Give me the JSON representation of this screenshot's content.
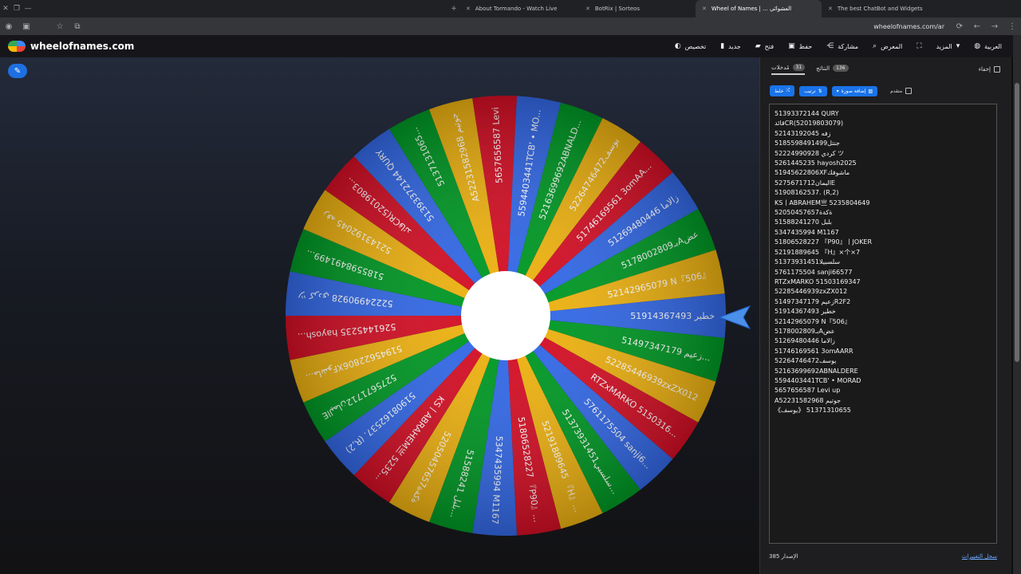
{
  "browser": {
    "tabs": [
      {
        "label": "About Tormando - Watch Live",
        "active": false
      },
      {
        "label": "BotRix | Sorteos",
        "active": false
      },
      {
        "label": "Wheel of Names | ... العشوائي",
        "active": true
      },
      {
        "label": "The best ChatBot and Widgets",
        "active": false
      }
    ],
    "url": "wheelofnames.com/ar"
  },
  "app": {
    "brand": "wheelofnames.com",
    "menu": [
      {
        "label": "تخصيص",
        "icon": "palette-icon"
      },
      {
        "label": "جديد",
        "icon": "new-file-icon"
      },
      {
        "label": "فتح",
        "icon": "folder-icon"
      },
      {
        "label": "حفظ",
        "icon": "save-icon"
      },
      {
        "label": "مشاركة",
        "icon": "share-icon"
      },
      {
        "label": "المعرض",
        "icon": "search-icon"
      },
      {
        "label": "المزيد",
        "icon": "fullscreen-icon"
      },
      {
        "label": "العربية",
        "icon": "globe-icon"
      }
    ]
  },
  "panel": {
    "tabs": [
      {
        "label": "مُدخلات",
        "count": "31"
      },
      {
        "label": "النتائج",
        "count": "136"
      }
    ],
    "hide_label": "إخفاء",
    "tools": {
      "shuffle": "خلط",
      "sort": "ترتيب",
      "add_image": "إضافة صورة",
      "advanced": "متقدم"
    },
    "version_label": "الإصدار",
    "version": "385",
    "changelog": "سجل التغييرات"
  },
  "entries": [
    "51393372144 QURY",
    "قائدCR(52019803079)",
    "52143192045 زفه",
    "5185598491499جنتل",
    "52224990928 كردي ツ",
    "5261445235 hayosh2025",
    "51945622806XFماشوفك",
    "5275671712اليمانE",
    "51908162537. (R,2)",
    "KS丨ABRAHEM亗 5235804649",
    "52050457657ةكةة",
    "51588241270 بلبل",
    "5347435994 M1167",
    "51806528227 『P90』丨JOKER",
    "52191889645 『H』×个×7",
    "51373931451سلسبيلا",
    "5761175504 sanji66577",
    "RTZxMARKO 51503169347",
    "52285446939zxZX012",
    "51497347179 زعيمR2F2",
    "51914367493 خطير",
    "52142965079 N『506』",
    "5178002809بـAعض",
    "51269480446 زالاما",
    "51746169561 3omAARR",
    "52264746472يوسف",
    "52163699692ABNALDERE",
    "5594403441TCB' • MORAD",
    "5657656587 Levi up",
    "A52231582968 جوتيم",
    "《يوسف》 51371310655"
  ],
  "wheel": {
    "colors": [
      "#3369e8",
      "#009925",
      "#eeb211",
      "#d50f25"
    ],
    "labels_from_right_clockwise": [
      "51914367493 خطير",
      "51497347179 زعيم...",
      "52285446939zxZX012",
      "RTZxMARKO 5150316...",
      "5761175504 sanji6...",
      "51373931451سلسبي...",
      "52191889645 『H』...",
      "51806528227 『P90』...",
      "5347435994 M1167",
      "51588241 بلبل...",
      "52050457657ةكةة",
      "KS丨ABRAHEM亗 5235...",
      "51908162537. (R,2)",
      "5275671712اليمانE",
      "51945622806XFماشو...",
      "5261445235 hayosh...",
      "52224990928 كردي ツ",
      "5185598491499...",
      "52143192045 زفه",
      "قائدCR(52019803...",
      "51393372144 QURY",
      "5137131065...",
      "A52231582968 جوتيم",
      "5657656587 Levi",
      "5594403441TCB' • MO...",
      "52163699692ABNALD...",
      "52264746472يوسف",
      "51746169561 3omAA...",
      "51269480446 زالاما",
      "5178002809بـAعض",
      "52142965079 N『506』"
    ]
  }
}
